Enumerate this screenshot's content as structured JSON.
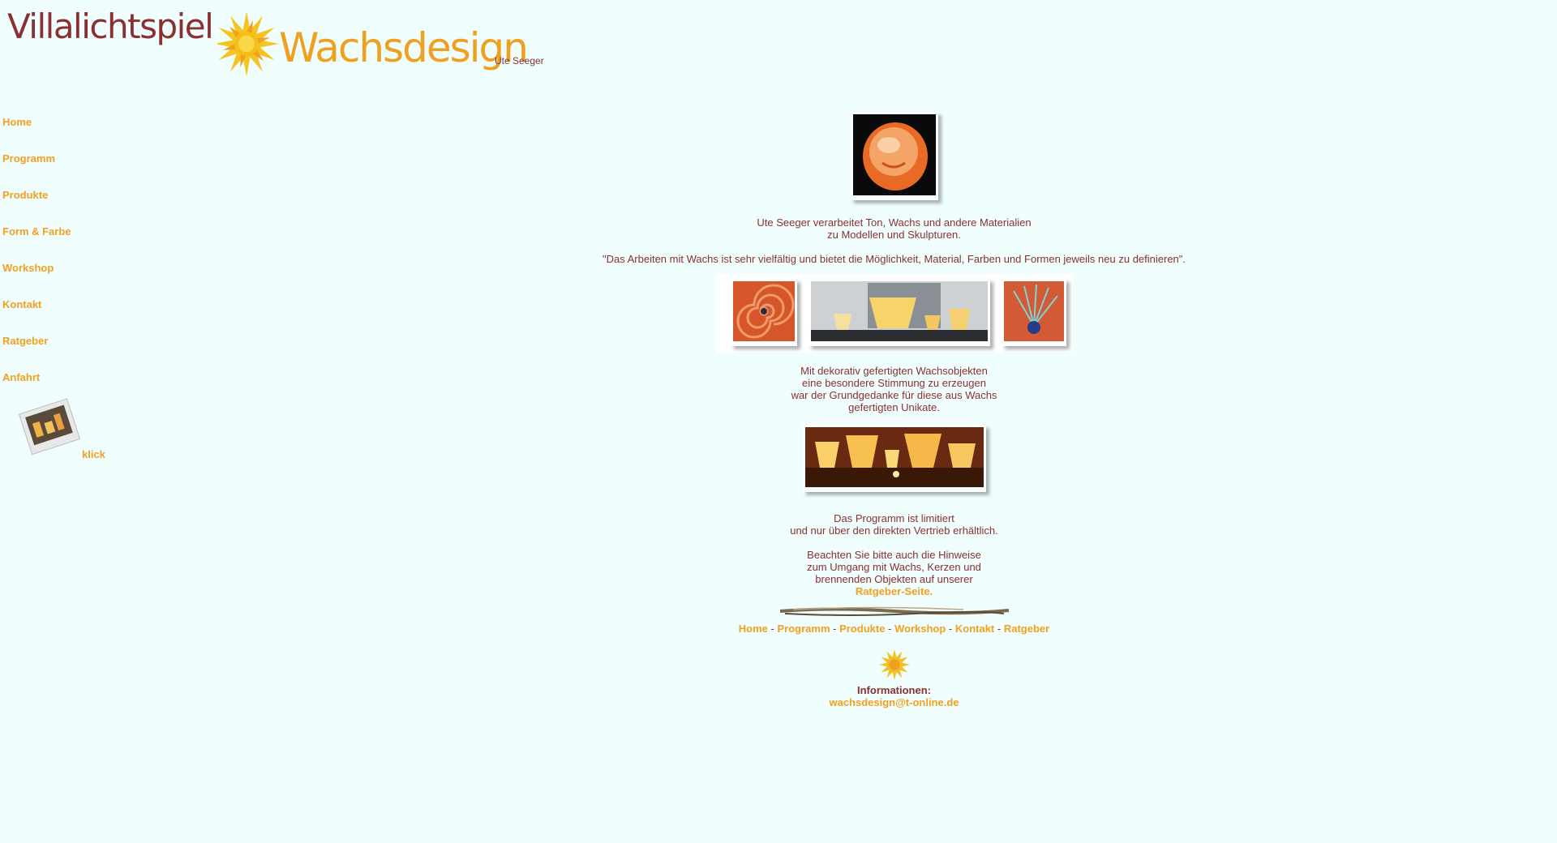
{
  "header": {
    "brand_primary": "Villalichtspiel",
    "brand_secondary": "Wachsdesign",
    "brand_owner": "Ute Seeger"
  },
  "sidebar": {
    "items": [
      {
        "label": "Home"
      },
      {
        "label": "Programm"
      },
      {
        "label": "Produkte"
      },
      {
        "label": "Form & Farbe"
      },
      {
        "label": "Workshop"
      },
      {
        "label": "Kontakt"
      },
      {
        "label": "Ratgeber"
      },
      {
        "label": "Anfahrt"
      }
    ],
    "klick_label": "klick"
  },
  "main": {
    "intro_line1": "Ute Seeger verarbeitet Ton, Wachs und andere Materialien",
    "intro_line2": "zu Modellen und Skulpturen.",
    "quote": "\"Das Arbeiten mit Wachs ist sehr vielfältig und bietet die Möglichkeit, Material, Farben und Formen jeweils neu zu definieren\".",
    "deco_line1": "Mit dekorativ gefertigten Wachsobjekten",
    "deco_line2": "eine besondere Stimmung zu erzeugen",
    "deco_line3": "war der Grundgedanke für diese aus Wachs",
    "deco_line4": "gefertigten Unikate.",
    "program_line1": "Das Programm ist limitiert",
    "program_line2": "und nur über den direkten Vertrieb erhältlich.",
    "hint_line1": "Beachten Sie bitte auch die Hinweise",
    "hint_line2": "zum Umgang mit Wachs, Kerzen und",
    "hint_line3": "brennenden Objekten auf unserer",
    "hint_link": "Ratgeber-Seite.",
    "footer_nav": [
      {
        "label": "Home"
      },
      {
        "label": "Programm"
      },
      {
        "label": "Produkte"
      },
      {
        "label": "Workshop"
      },
      {
        "label": "Kontakt"
      },
      {
        "label": "Ratgeber"
      }
    ],
    "footer_sep": " - ",
    "info_title": "Informationen:",
    "info_email": "wachsdesign@t-online.de"
  },
  "colors": {
    "background": "#f0fffe",
    "text": "#8b2f32",
    "link": "#f2a020"
  }
}
